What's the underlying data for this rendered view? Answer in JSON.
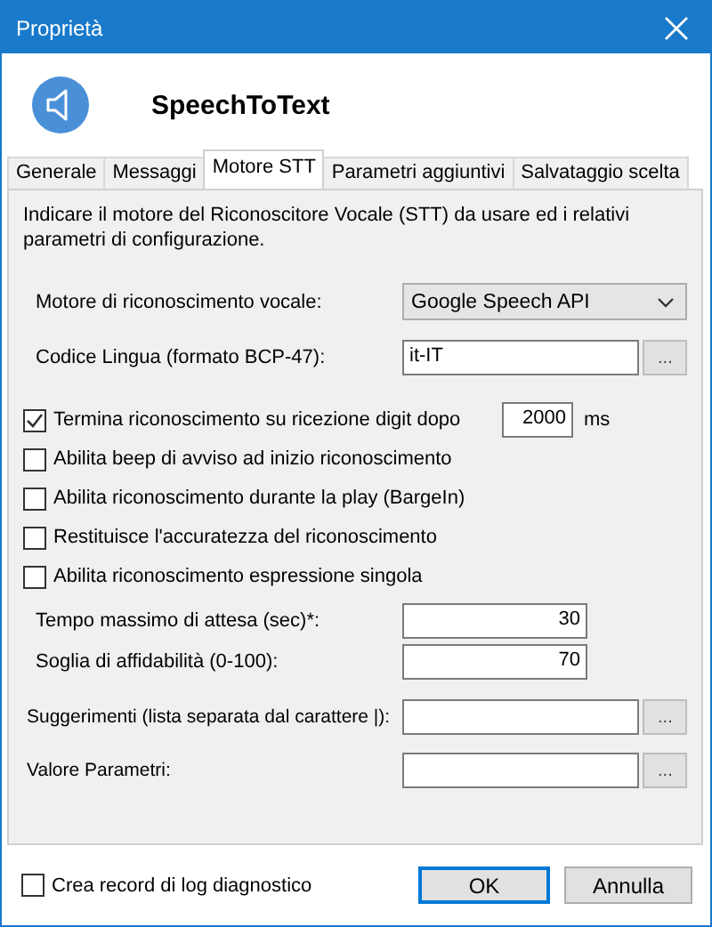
{
  "window": {
    "title": "Proprietà"
  },
  "header": {
    "title": "SpeechToText"
  },
  "tabs": [
    {
      "label": "Generale",
      "selected": false
    },
    {
      "label": "Messaggi",
      "selected": false
    },
    {
      "label": "Motore STT",
      "selected": true
    },
    {
      "label": "Parametri aggiuntivi",
      "selected": false
    },
    {
      "label": "Salvataggio scelta",
      "selected": false
    }
  ],
  "description": "Indicare il motore del Riconoscitore Vocale (STT) da usare ed i relativi parametri di configurazione.",
  "fields": [
    {
      "kind": "dropdown",
      "label": "Motore di riconoscimento vocale:",
      "value": "Google Speech API"
    },
    {
      "kind": "browse",
      "label": "Codice Lingua (formato BCP-47):",
      "value": "it-IT",
      "button": "..."
    }
  ],
  "options": [
    {
      "label": "Termina riconoscimento su ricezione digit dopo",
      "checked": true,
      "value": "2000",
      "unit": "ms"
    },
    {
      "label": "Abilita beep di avviso ad inizio riconoscimento",
      "checked": false
    },
    {
      "label": "Abilita riconoscimento durante la play (BargeIn)",
      "checked": false
    },
    {
      "label": "Restituisce l'accuratezza del riconoscimento",
      "checked": false
    },
    {
      "label": "Abilita riconoscimento espressione singola",
      "checked": false
    }
  ],
  "numbers": [
    {
      "label": "Tempo massimo di attesa (sec)*:",
      "value": "30"
    },
    {
      "label": "Soglia di affidabilità (0-100):",
      "value": "70"
    }
  ],
  "extra_fields": [
    {
      "label": "Suggerimenti (lista separata dal carattere |):",
      "button": "..."
    },
    {
      "label": "Valore Parametri:",
      "button": "..."
    }
  ],
  "footer": {
    "log": {
      "label": "Crea record di log diagnostico",
      "checked": false
    },
    "buttons": [
      {
        "label": "OK",
        "default": true
      },
      {
        "label": "Annulla",
        "default": false
      }
    ]
  }
}
